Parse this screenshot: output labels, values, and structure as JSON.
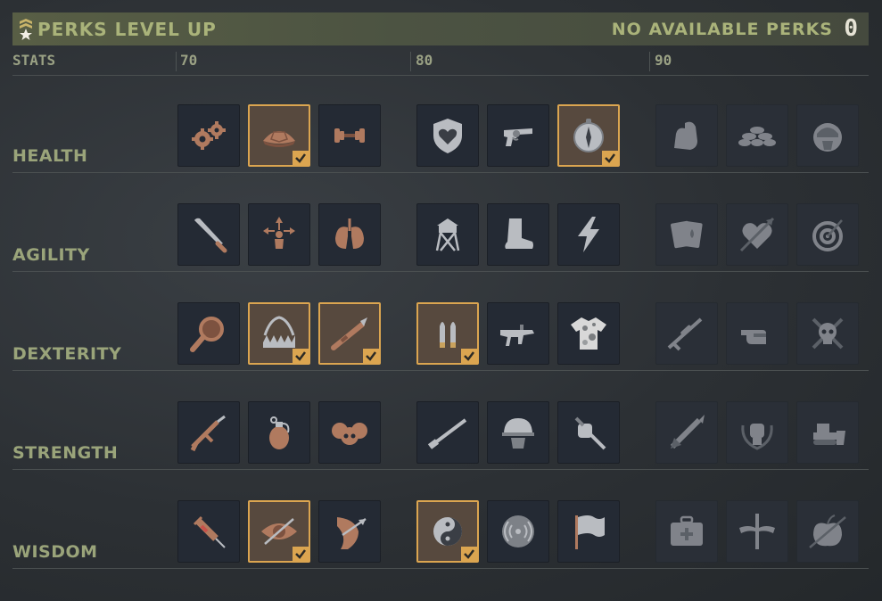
{
  "header": {
    "title": "PERKS LEVEL UP",
    "availability_label": "NO AVAILABLE PERKS",
    "available_count": "0"
  },
  "columns": {
    "stats_label": "STATS",
    "tiers": [
      "70",
      "80",
      "90"
    ]
  },
  "rows": [
    {
      "label": "HEALTH",
      "perks": [
        {
          "icon": "gears-icon",
          "selected": false,
          "locked": false
        },
        {
          "icon": "turtle-shell-icon",
          "selected": true,
          "locked": false
        },
        {
          "icon": "dumbbell-icon",
          "selected": false,
          "locked": false
        },
        {
          "icon": "heart-shield-icon",
          "selected": false,
          "locked": false
        },
        {
          "icon": "revolver-icon",
          "selected": false,
          "locked": false
        },
        {
          "icon": "compass-icon",
          "selected": true,
          "locked": false
        },
        {
          "icon": "flexed-arm-icon",
          "selected": false,
          "locked": true
        },
        {
          "icon": "sandbags-icon",
          "selected": false,
          "locked": true
        },
        {
          "icon": "helmet-head-icon",
          "selected": false,
          "locked": true
        }
      ]
    },
    {
      "label": "AGILITY",
      "perks": [
        {
          "icon": "machete-icon",
          "selected": false,
          "locked": false
        },
        {
          "icon": "dodge-arrows-icon",
          "selected": false,
          "locked": false
        },
        {
          "icon": "lungs-icon",
          "selected": false,
          "locked": false
        },
        {
          "icon": "watchtower-icon",
          "selected": false,
          "locked": false
        },
        {
          "icon": "boot-icon",
          "selected": false,
          "locked": false
        },
        {
          "icon": "lightning-icon",
          "selected": false,
          "locked": false
        },
        {
          "icon": "playing-cards-icon",
          "selected": false,
          "locked": true
        },
        {
          "icon": "heart-arrow-icon",
          "selected": false,
          "locked": true
        },
        {
          "icon": "target-icon",
          "selected": false,
          "locked": true
        }
      ]
    },
    {
      "label": "DEXTERITY",
      "perks": [
        {
          "icon": "magnifier-icon",
          "selected": false,
          "locked": false
        },
        {
          "icon": "bear-trap-icon",
          "selected": true,
          "locked": false
        },
        {
          "icon": "rocket-launcher-icon",
          "selected": true,
          "locked": false
        },
        {
          "icon": "bullets-icon",
          "selected": true,
          "locked": false
        },
        {
          "icon": "smg-icon",
          "selected": false,
          "locked": false
        },
        {
          "icon": "camo-shirt-icon",
          "selected": false,
          "locked": false
        },
        {
          "icon": "sniper-rifle-icon",
          "selected": false,
          "locked": true
        },
        {
          "icon": "finger-gun-icon",
          "selected": false,
          "locked": true
        },
        {
          "icon": "skull-crossbones-icon",
          "selected": false,
          "locked": true
        }
      ]
    },
    {
      "label": "STRENGTH",
      "perks": [
        {
          "icon": "assault-rifle-icon",
          "selected": false,
          "locked": false
        },
        {
          "icon": "grenade-icon",
          "selected": false,
          "locked": false
        },
        {
          "icon": "skulls-icon",
          "selected": false,
          "locked": false
        },
        {
          "icon": "shotgun-icon",
          "selected": false,
          "locked": false
        },
        {
          "icon": "soldier-helmet-icon",
          "selected": false,
          "locked": false
        },
        {
          "icon": "knife-fist-icon",
          "selected": false,
          "locked": false
        },
        {
          "icon": "missile-icon",
          "selected": false,
          "locked": true
        },
        {
          "icon": "fist-wreath-icon",
          "selected": false,
          "locked": true
        },
        {
          "icon": "bulldozer-icon",
          "selected": false,
          "locked": true
        }
      ]
    },
    {
      "label": "WISDOM",
      "perks": [
        {
          "icon": "syringe-icon",
          "selected": false,
          "locked": false
        },
        {
          "icon": "eye-arrow-icon",
          "selected": true,
          "locked": false
        },
        {
          "icon": "shoulder-arrow-icon",
          "selected": false,
          "locked": false
        },
        {
          "icon": "yin-yang-icon",
          "selected": true,
          "locked": false
        },
        {
          "icon": "signal-icon",
          "selected": false,
          "locked": false
        },
        {
          "icon": "flag-icon",
          "selected": false,
          "locked": false
        },
        {
          "icon": "medkit-icon",
          "selected": false,
          "locked": true
        },
        {
          "icon": "winged-sword-icon",
          "selected": false,
          "locked": true
        },
        {
          "icon": "apple-arrow-icon",
          "selected": false,
          "locked": true
        }
      ]
    }
  ],
  "colors": {
    "accent_header": "#aab37a",
    "row_label": "#9aa47a",
    "selected_border": "#dba550",
    "icon_copper": "#b07a5f",
    "icon_silver": "#b9bcc1"
  }
}
